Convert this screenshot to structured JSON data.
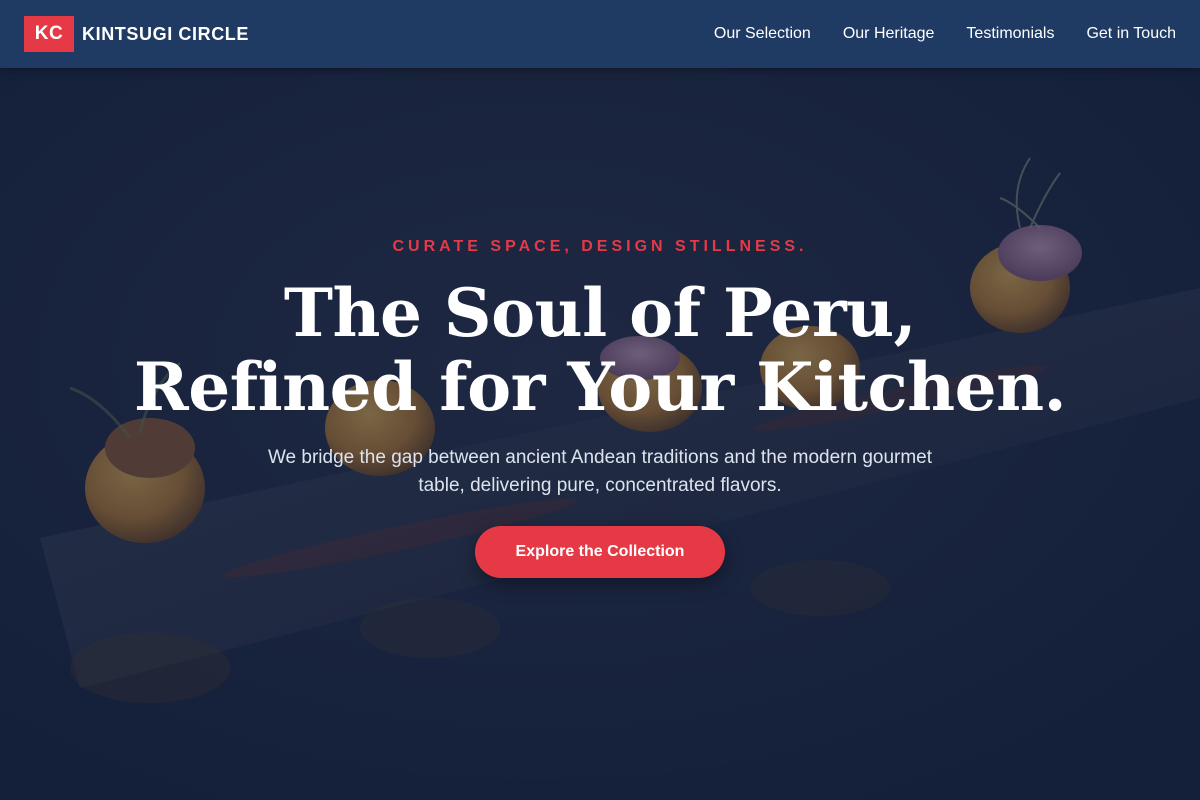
{
  "header": {
    "logo_initials": "KC",
    "brand_name": "KINTSUGI CIRCLE",
    "nav": [
      {
        "label": "Our Selection"
      },
      {
        "label": "Our Heritage"
      },
      {
        "label": "Testimonials"
      },
      {
        "label": "Get in Touch"
      }
    ]
  },
  "hero": {
    "eyebrow": "CURATE SPACE, DESIGN STILLNESS.",
    "headline_line1": "The Soul of Peru,",
    "headline_line2": "Refined for Your Kitchen.",
    "subtext": "We bridge the gap between ancient Andean traditions and the modern gourmet table, delivering pure, concentrated flavors.",
    "cta_label": "Explore the Collection",
    "background_image": "dark slate platter with Peruvian stuffed potatoes"
  },
  "colors": {
    "accent": "#e63946",
    "header_bg": "#1f3a63",
    "page_bg": "#15233f",
    "text_light": "#ffffff"
  }
}
